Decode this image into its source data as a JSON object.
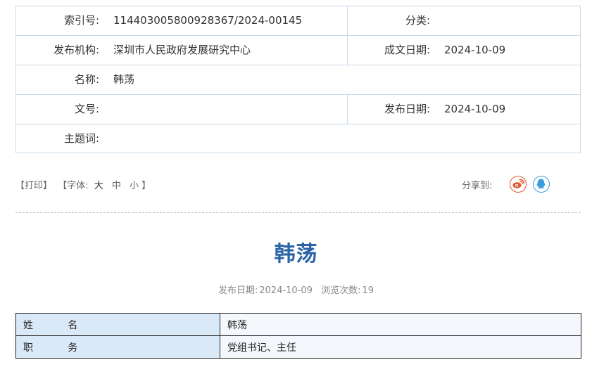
{
  "meta": {
    "index_label": "索引号:",
    "index_value": "11440300580092836​7/2024-00145",
    "category_label": "分类:",
    "category_value": "",
    "publisher_label": "发布机构:",
    "publisher_value": "深圳市人民政府发展研究中心",
    "created_label": "成文日期:",
    "created_value": "2024-10-09",
    "name_label": "名称:",
    "name_value": "韩荡",
    "docno_label": "文号:",
    "docno_value": "",
    "published_label": "发布日期:",
    "published_value": "2024-10-09",
    "subject_label": "主题词:",
    "subject_value": ""
  },
  "tools": {
    "print": "【打印】",
    "font_open": "【字体:",
    "font_large": "大",
    "font_medium": "中",
    "font_small": "小",
    "font_close": "】",
    "share_label": "分享到:"
  },
  "icons": {
    "weibo": "weibo-icon",
    "qq": "qq-icon"
  },
  "article": {
    "title": "韩荡",
    "date_label": "发布日期:",
    "date_value": "2024-10-09",
    "views_label": "浏览次数:",
    "views_value": "19"
  },
  "info_table": [
    {
      "key": "姓 名",
      "value": "韩荡"
    },
    {
      "key": "职 务",
      "value": "党组书记、主任"
    }
  ],
  "colors": {
    "title": "#2b64a6",
    "border": "#c9d9e8",
    "key_bg": "#d9e9f7",
    "weibo": "#e4572e",
    "qq": "#3b9ede"
  }
}
